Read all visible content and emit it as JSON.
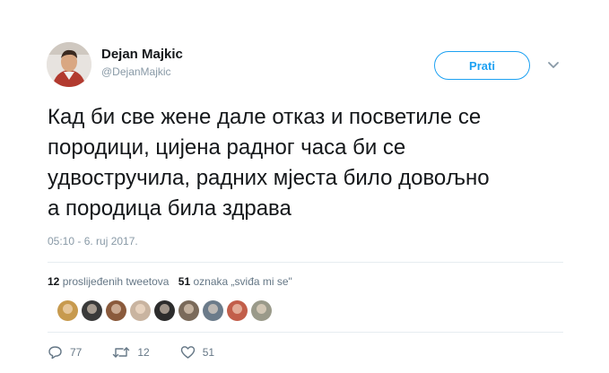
{
  "author": {
    "display_name": "Dejan Majkic",
    "handle": "@DejanMajkic"
  },
  "follow_label": "Prati",
  "tweet_text": "Кад би све жене дале отказ и посветиле се\nпородици, цијена радног часа би се\nудвостручила, радних мјеста било довољно\nа породица била здрава",
  "timestamp": "05:10 - 6. ruj 2017.",
  "stats": {
    "retweets_count": "12",
    "retweets_label": "proslijeđenih tweetova",
    "likes_count": "51",
    "likes_label": "oznaka „sviđa mi se\""
  },
  "liker_avatar_colors": [
    "#c79a4e",
    "#3a3a3a",
    "#8a5a3c",
    "#c9b4a0",
    "#2c2c2c",
    "#7a6a5a",
    "#6b7b8a",
    "#c25e4a",
    "#9a9a8a"
  ],
  "actions": {
    "reply_count": "77",
    "retweet_count": "12",
    "like_count": "51"
  },
  "colors": {
    "accent": "#1da1f2",
    "muted": "#657786"
  },
  "icons": [
    "caret-down-icon",
    "reply-icon",
    "retweet-icon",
    "heart-icon"
  ]
}
